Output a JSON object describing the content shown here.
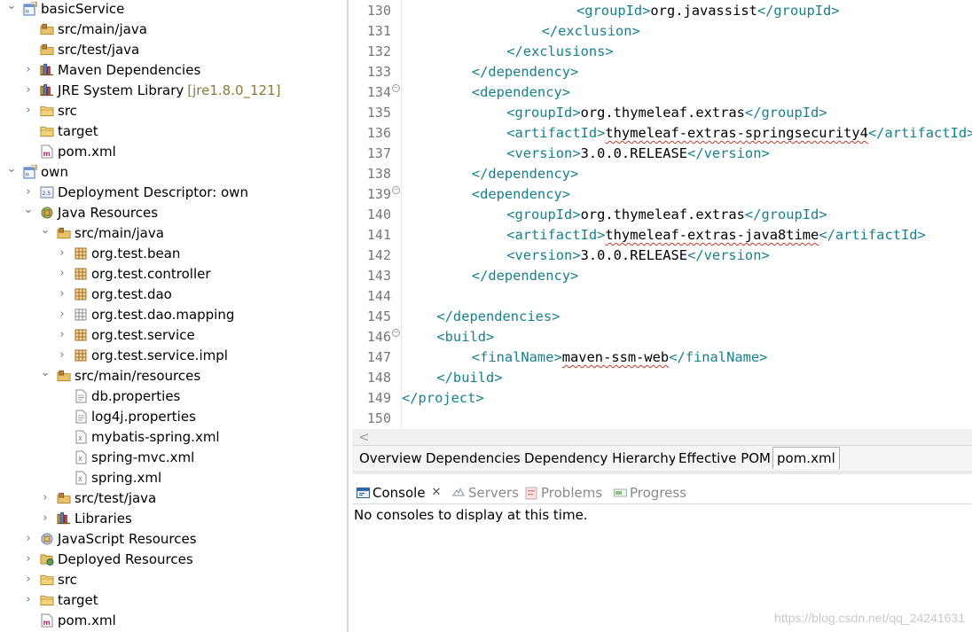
{
  "explorer": {
    "items": [
      {
        "label": "basicService",
        "icon": "project-icon",
        "twisty": "open",
        "level": 0
      },
      {
        "label": "src/main/java",
        "icon": "source-folder-icon",
        "twisty": "none",
        "level": 1
      },
      {
        "label": "src/test/java",
        "icon": "source-folder-icon",
        "twisty": "none",
        "level": 1
      },
      {
        "label": "Maven Dependencies",
        "icon": "library-icon",
        "twisty": "closed",
        "level": 1
      },
      {
        "label": "JRE System Library",
        "decoration": "[jre1.8.0_121]",
        "icon": "library-icon",
        "twisty": "closed",
        "level": 1
      },
      {
        "label": "src",
        "icon": "folder-icon",
        "twisty": "closed",
        "level": 1
      },
      {
        "label": "target",
        "icon": "folder-icon",
        "twisty": "none",
        "level": 1
      },
      {
        "label": "pom.xml",
        "icon": "maven-file-icon",
        "twisty": "none",
        "level": 1
      },
      {
        "label": "own",
        "icon": "project-icon",
        "twisty": "open",
        "level": 0
      },
      {
        "label": "Deployment Descriptor: own",
        "icon": "deployment-descriptor-icon",
        "twisty": "closed",
        "level": 1
      },
      {
        "label": "Java Resources",
        "icon": "java-resources-icon",
        "twisty": "open",
        "level": 1
      },
      {
        "label": "src/main/java",
        "icon": "source-folder-icon",
        "twisty": "open",
        "level": 2
      },
      {
        "label": "org.test.bean",
        "icon": "package-icon",
        "twisty": "closed",
        "level": 3
      },
      {
        "label": "org.test.controller",
        "icon": "package-icon",
        "twisty": "closed",
        "level": 3
      },
      {
        "label": "org.test.dao",
        "icon": "package-icon",
        "twisty": "closed",
        "level": 3
      },
      {
        "label": "org.test.dao.mapping",
        "icon": "empty-package-icon",
        "twisty": "closed",
        "level": 3
      },
      {
        "label": "org.test.service",
        "icon": "package-icon",
        "twisty": "closed",
        "level": 3
      },
      {
        "label": "org.test.service.impl",
        "icon": "package-icon",
        "twisty": "closed",
        "level": 3
      },
      {
        "label": "src/main/resources",
        "icon": "source-folder-icon",
        "twisty": "open",
        "level": 2
      },
      {
        "label": "db.properties",
        "icon": "properties-file-icon",
        "twisty": "none",
        "level": 3
      },
      {
        "label": "log4j.properties",
        "icon": "properties-file-icon",
        "twisty": "none",
        "level": 3
      },
      {
        "label": "mybatis-spring.xml",
        "icon": "xml-file-icon",
        "twisty": "none",
        "level": 3
      },
      {
        "label": "spring-mvc.xml",
        "icon": "xml-file-icon",
        "twisty": "none",
        "level": 3
      },
      {
        "label": "spring.xml",
        "icon": "xml-file-icon",
        "twisty": "none",
        "level": 3
      },
      {
        "label": "src/test/java",
        "icon": "source-folder-icon",
        "twisty": "closed",
        "level": 2
      },
      {
        "label": "Libraries",
        "icon": "library-icon",
        "twisty": "closed",
        "level": 2
      },
      {
        "label": "JavaScript Resources",
        "icon": "javascript-resources-icon",
        "twisty": "closed",
        "level": 1
      },
      {
        "label": "Deployed Resources",
        "icon": "deployed-resources-icon",
        "twisty": "closed",
        "level": 1
      },
      {
        "label": "src",
        "icon": "folder-icon",
        "twisty": "closed",
        "level": 1
      },
      {
        "label": "target",
        "icon": "folder-icon",
        "twisty": "closed",
        "level": 1
      },
      {
        "label": "pom.xml",
        "icon": "maven-file-icon",
        "twisty": "none",
        "level": 1
      }
    ]
  },
  "editor": {
    "lines": [
      {
        "num": "130",
        "fold": false,
        "indent": 20,
        "parts": [
          [
            "tag",
            "<groupId>"
          ],
          [
            "txt",
            "org.javassist"
          ],
          [
            "tag",
            "</groupId>"
          ]
        ]
      },
      {
        "num": "131",
        "fold": false,
        "indent": 16,
        "parts": [
          [
            "tag",
            "</exclusion>"
          ]
        ]
      },
      {
        "num": "132",
        "fold": false,
        "indent": 12,
        "parts": [
          [
            "tag",
            "</exclusions>"
          ]
        ]
      },
      {
        "num": "133",
        "fold": false,
        "indent": 8,
        "parts": [
          [
            "tag",
            "</dependency>"
          ]
        ]
      },
      {
        "num": "134",
        "fold": true,
        "indent": 8,
        "parts": [
          [
            "tag",
            "<dependency>"
          ]
        ]
      },
      {
        "num": "135",
        "fold": false,
        "indent": 12,
        "parts": [
          [
            "tag",
            "<groupId>"
          ],
          [
            "txt",
            "org.thymeleaf.extras"
          ],
          [
            "tag",
            "</groupId>"
          ]
        ]
      },
      {
        "num": "136",
        "fold": false,
        "indent": 12,
        "parts": [
          [
            "tag",
            "<artifactId>"
          ],
          [
            "sq",
            "thymeleaf-extras-springsecurity4"
          ],
          [
            "tag",
            "</artifactId>"
          ]
        ]
      },
      {
        "num": "137",
        "fold": false,
        "indent": 12,
        "parts": [
          [
            "tag",
            "<version>"
          ],
          [
            "txt",
            "3.0.0.RELEASE"
          ],
          [
            "tag",
            "</version>"
          ]
        ]
      },
      {
        "num": "138",
        "fold": false,
        "indent": 8,
        "parts": [
          [
            "tag",
            "</dependency>"
          ]
        ]
      },
      {
        "num": "139",
        "fold": true,
        "indent": 8,
        "parts": [
          [
            "tag",
            "<dependency>"
          ]
        ]
      },
      {
        "num": "140",
        "fold": false,
        "indent": 12,
        "parts": [
          [
            "tag",
            "<groupId>"
          ],
          [
            "txt",
            "org.thymeleaf.extras"
          ],
          [
            "tag",
            "</groupId>"
          ]
        ]
      },
      {
        "num": "141",
        "fold": false,
        "indent": 12,
        "parts": [
          [
            "tag",
            "<artifactId>"
          ],
          [
            "sq",
            "thymeleaf-extras-java8time"
          ],
          [
            "tag",
            "</artifactId>"
          ]
        ]
      },
      {
        "num": "142",
        "fold": false,
        "indent": 12,
        "parts": [
          [
            "tag",
            "<version>"
          ],
          [
            "txt",
            "3.0.0.RELEASE"
          ],
          [
            "tag",
            "</version>"
          ]
        ]
      },
      {
        "num": "143",
        "fold": false,
        "indent": 8,
        "parts": [
          [
            "tag",
            "</dependency>"
          ]
        ]
      },
      {
        "num": "144",
        "fold": false,
        "indent": 0,
        "parts": []
      },
      {
        "num": "145",
        "fold": false,
        "indent": 4,
        "parts": [
          [
            "tag",
            "</dependencies>"
          ]
        ]
      },
      {
        "num": "146",
        "fold": true,
        "indent": 4,
        "parts": [
          [
            "tag",
            "<build>"
          ]
        ]
      },
      {
        "num": "147",
        "fold": false,
        "indent": 8,
        "parts": [
          [
            "tag",
            "<finalName>"
          ],
          [
            "sq",
            "maven-ssm-web"
          ],
          [
            "tag",
            "</finalName>"
          ]
        ]
      },
      {
        "num": "148",
        "fold": false,
        "indent": 4,
        "parts": [
          [
            "tag",
            "</build>"
          ]
        ]
      },
      {
        "num": "149",
        "fold": false,
        "indent": 0,
        "parts": [
          [
            "tag",
            "</project>"
          ]
        ]
      },
      {
        "num": "150",
        "fold": false,
        "indent": 0,
        "parts": []
      }
    ],
    "scroll_left_arrow": "<"
  },
  "pom_tabs": {
    "overview": "Overview",
    "dependencies": "Dependencies",
    "hierarchy": "Dependency Hierarchy",
    "effective": "Effective POM",
    "pom_xml": "pom.xml"
  },
  "views": {
    "console": "Console",
    "console_close": "✕",
    "servers": "Servers",
    "problems": "Problems",
    "progress": "Progress",
    "message": "No consoles to display at this time."
  },
  "watermark": "https://blog.csdn.net/qq_24241631",
  "colors": {
    "xml_tag": "#17808d",
    "line_number": "#787878",
    "squiggle": "#c0392b"
  }
}
